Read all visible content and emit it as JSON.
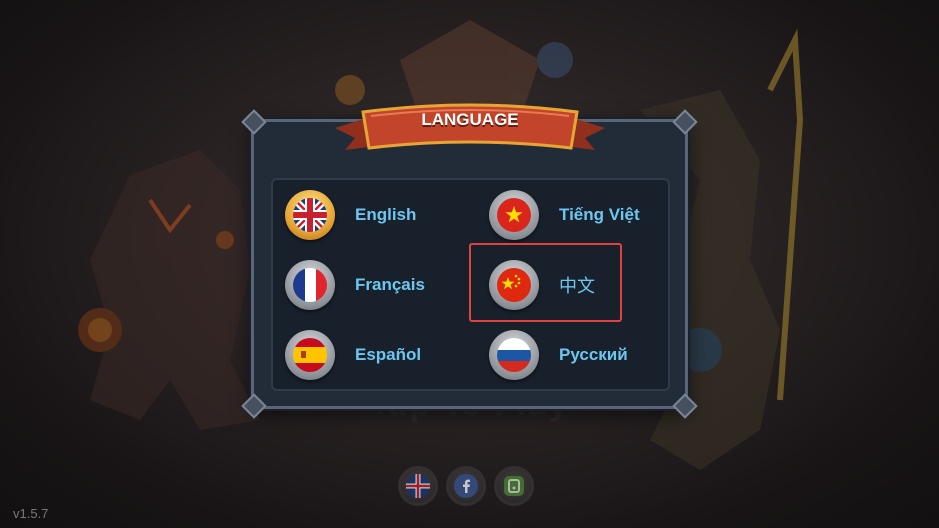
{
  "game": {
    "tap_to_play": "Tap To Play",
    "version": "v1.5.7"
  },
  "dialog": {
    "title": "LANGUAGE",
    "languages": [
      {
        "label": "English",
        "flag": "uk-flag-icon",
        "selected": true
      },
      {
        "label": "Tiếng Việt",
        "flag": "vietnam-flag-icon",
        "selected": false
      },
      {
        "label": "Français",
        "flag": "france-flag-icon",
        "selected": false
      },
      {
        "label": "中文",
        "flag": "china-flag-icon",
        "selected": false
      },
      {
        "label": "Español",
        "flag": "spain-flag-icon",
        "selected": false
      },
      {
        "label": "Русский",
        "flag": "russia-flag-icon",
        "selected": false
      }
    ],
    "highlighted_option": "中文"
  },
  "bottom_bar": {
    "icons": [
      "uk-flag-icon",
      "facebook-icon",
      "gamepad-icon"
    ]
  },
  "colors": {
    "label_blue": "#6ec6ef",
    "ribbon_red": "#c2442a",
    "selected_ring_gold": "#e7a634",
    "highlight_red": "#e3413f"
  }
}
